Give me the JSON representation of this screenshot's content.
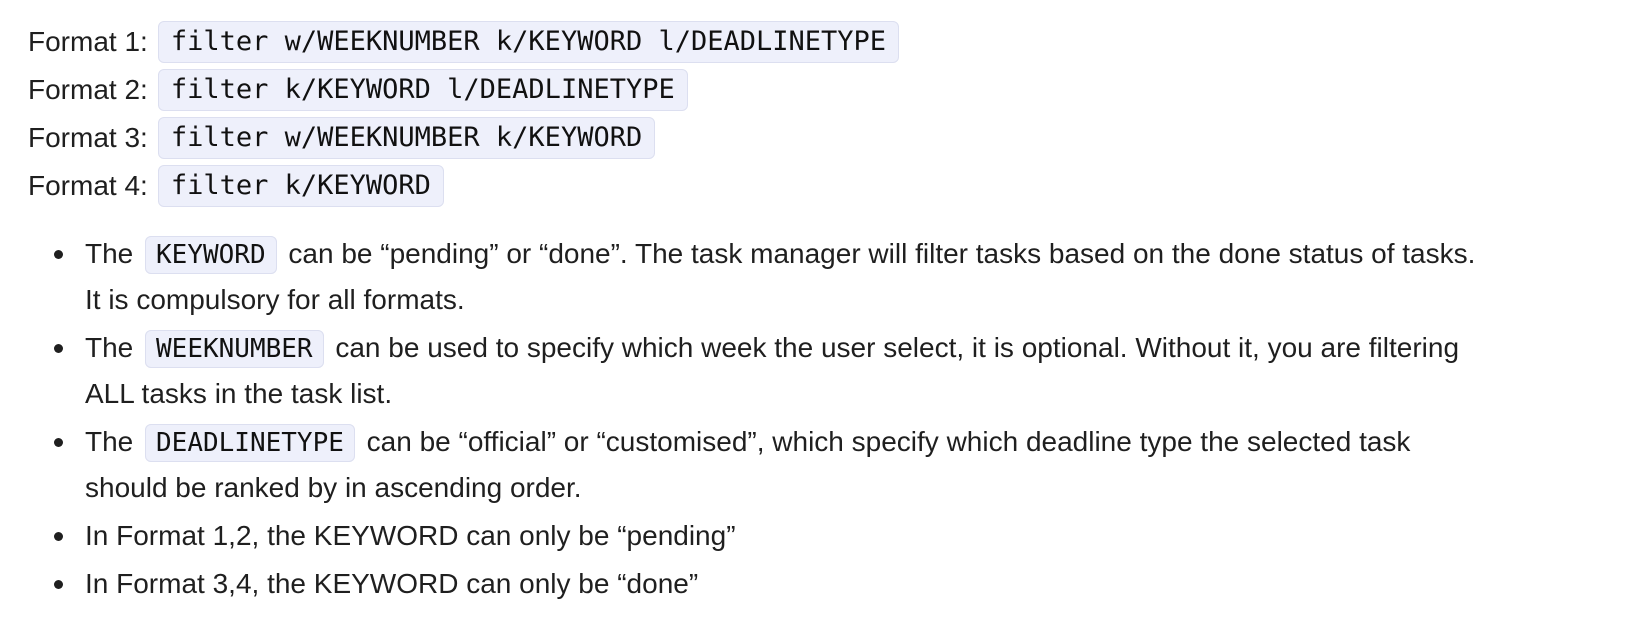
{
  "formats": [
    {
      "label": "Format 1:",
      "command": "filter w/WEEKNUMBER k/KEYWORD l/DEADLINETYPE"
    },
    {
      "label": "Format 2:",
      "command": "filter k/KEYWORD l/DEADLINETYPE"
    },
    {
      "label": "Format 3:",
      "command": "filter w/WEEKNUMBER k/KEYWORD"
    },
    {
      "label": "Format 4:",
      "command": "filter k/KEYWORD"
    }
  ],
  "notes": [
    {
      "prefix": "The",
      "code": "KEYWORD",
      "text": "can be “pending” or “done”. The task manager will filter tasks based on the done status of tasks. It is compulsory for all formats."
    },
    {
      "prefix": "The",
      "code": "WEEKNUMBER",
      "text": "can be used to specify which week the user select, it is optional. Without it, you are filtering ALL tasks in the task list."
    },
    {
      "prefix": "The",
      "code": "DEADLINETYPE",
      "text": "can be “official” or “customised”, which specify which deadline type the selected task should be ranked by in ascending order."
    },
    {
      "text": "In Format 1,2, the KEYWORD can only be “pending”"
    },
    {
      "text": "In Format 3,4, the KEYWORD can only be “done”"
    }
  ]
}
